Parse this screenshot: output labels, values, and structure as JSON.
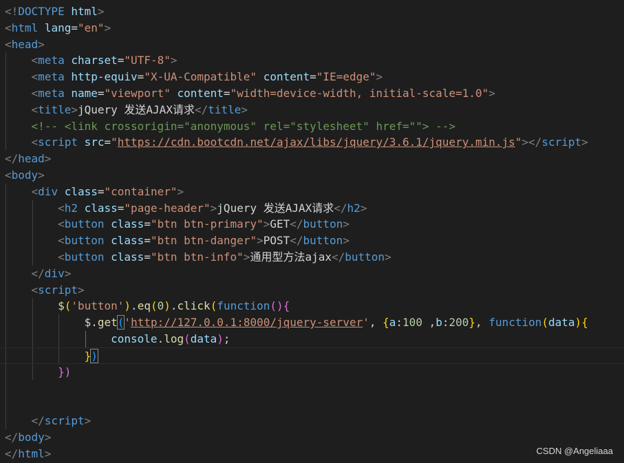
{
  "colors": {
    "background": "#1e1e1e",
    "tag": "#569cd6",
    "bracket": "#808080",
    "attribute": "#9cdcfe",
    "string": "#ce9178",
    "text": "#d4d4d4",
    "comment": "#6a9955",
    "function": "#dcdcaa",
    "number": "#b5cea8",
    "keyword": "#569cd6",
    "brace_gold": "#ffd700",
    "brace_purple": "#da70d6",
    "brace_blue": "#179fff"
  },
  "code": {
    "lines": [
      {
        "guides": [],
        "tokens": [
          {
            "t": "<!",
            "c": "bracket"
          },
          {
            "t": "DOCTYPE",
            "c": "tag"
          },
          {
            "t": " ",
            "c": "text"
          },
          {
            "t": "html",
            "c": "attribute"
          },
          {
            "t": ">",
            "c": "bracket"
          }
        ]
      },
      {
        "guides": [],
        "tokens": [
          {
            "t": "<",
            "c": "bracket"
          },
          {
            "t": "html",
            "c": "tag"
          },
          {
            "t": " ",
            "c": "text"
          },
          {
            "t": "lang",
            "c": "attribute"
          },
          {
            "t": "=",
            "c": "text"
          },
          {
            "t": "\"en\"",
            "c": "string"
          },
          {
            "t": ">",
            "c": "bracket"
          }
        ]
      },
      {
        "guides": [],
        "tokens": [
          {
            "t": "<",
            "c": "bracket"
          },
          {
            "t": "head",
            "c": "tag"
          },
          {
            "t": ">",
            "c": "bracket"
          }
        ]
      },
      {
        "guides": [
          1
        ],
        "tokens": [
          {
            "t": "    ",
            "c": "text"
          },
          {
            "t": "<",
            "c": "bracket"
          },
          {
            "t": "meta",
            "c": "tag"
          },
          {
            "t": " ",
            "c": "text"
          },
          {
            "t": "charset",
            "c": "attribute"
          },
          {
            "t": "=",
            "c": "text"
          },
          {
            "t": "\"UTF-8\"",
            "c": "string"
          },
          {
            "t": ">",
            "c": "bracket"
          }
        ]
      },
      {
        "guides": [
          1
        ],
        "tokens": [
          {
            "t": "    ",
            "c": "text"
          },
          {
            "t": "<",
            "c": "bracket"
          },
          {
            "t": "meta",
            "c": "tag"
          },
          {
            "t": " ",
            "c": "text"
          },
          {
            "t": "http-equiv",
            "c": "attribute"
          },
          {
            "t": "=",
            "c": "text"
          },
          {
            "t": "\"X-UA-Compatible\"",
            "c": "string"
          },
          {
            "t": " ",
            "c": "text"
          },
          {
            "t": "content",
            "c": "attribute"
          },
          {
            "t": "=",
            "c": "text"
          },
          {
            "t": "\"IE=edge\"",
            "c": "string"
          },
          {
            "t": ">",
            "c": "bracket"
          }
        ]
      },
      {
        "guides": [
          1
        ],
        "tokens": [
          {
            "t": "    ",
            "c": "text"
          },
          {
            "t": "<",
            "c": "bracket"
          },
          {
            "t": "meta",
            "c": "tag"
          },
          {
            "t": " ",
            "c": "text"
          },
          {
            "t": "name",
            "c": "attribute"
          },
          {
            "t": "=",
            "c": "text"
          },
          {
            "t": "\"viewport\"",
            "c": "string"
          },
          {
            "t": " ",
            "c": "text"
          },
          {
            "t": "content",
            "c": "attribute"
          },
          {
            "t": "=",
            "c": "text"
          },
          {
            "t": "\"width=device-width, initial-scale=1.0\"",
            "c": "string"
          },
          {
            "t": ">",
            "c": "bracket"
          }
        ]
      },
      {
        "guides": [
          1
        ],
        "tokens": [
          {
            "t": "    ",
            "c": "text"
          },
          {
            "t": "<",
            "c": "bracket"
          },
          {
            "t": "title",
            "c": "tag"
          },
          {
            "t": ">",
            "c": "bracket"
          },
          {
            "t": "jQuery 发送AJAX请求",
            "c": "text"
          },
          {
            "t": "</",
            "c": "bracket"
          },
          {
            "t": "title",
            "c": "tag"
          },
          {
            "t": ">",
            "c": "bracket"
          }
        ]
      },
      {
        "guides": [
          1
        ],
        "tokens": [
          {
            "t": "    ",
            "c": "text"
          },
          {
            "t": "<!-- <link crossorigin=\"anonymous\" rel=\"stylesheet\" href=\"\"> -->",
            "c": "comment"
          }
        ]
      },
      {
        "guides": [
          1
        ],
        "tokens": [
          {
            "t": "    ",
            "c": "text"
          },
          {
            "t": "<",
            "c": "bracket"
          },
          {
            "t": "script",
            "c": "tag"
          },
          {
            "t": " ",
            "c": "text"
          },
          {
            "t": "src",
            "c": "attribute"
          },
          {
            "t": "=",
            "c": "text"
          },
          {
            "t": "\"",
            "c": "string"
          },
          {
            "t": "https://cdn.bootcdn.net/ajax/libs/jquery/3.6.1/jquery.min.js",
            "c": "string",
            "u": true
          },
          {
            "t": "\"",
            "c": "string"
          },
          {
            "t": "></",
            "c": "bracket"
          },
          {
            "t": "script",
            "c": "tag"
          },
          {
            "t": ">",
            "c": "bracket"
          }
        ]
      },
      {
        "guides": [],
        "tokens": [
          {
            "t": "</",
            "c": "bracket"
          },
          {
            "t": "head",
            "c": "tag"
          },
          {
            "t": ">",
            "c": "bracket"
          }
        ]
      },
      {
        "guides": [],
        "tokens": [
          {
            "t": "<",
            "c": "bracket"
          },
          {
            "t": "body",
            "c": "tag"
          },
          {
            "t": ">",
            "c": "bracket"
          }
        ]
      },
      {
        "guides": [
          1
        ],
        "tokens": [
          {
            "t": "    ",
            "c": "text"
          },
          {
            "t": "<",
            "c": "bracket"
          },
          {
            "t": "div",
            "c": "tag"
          },
          {
            "t": " ",
            "c": "text"
          },
          {
            "t": "class",
            "c": "attribute"
          },
          {
            "t": "=",
            "c": "text"
          },
          {
            "t": "\"container\"",
            "c": "string"
          },
          {
            "t": ">",
            "c": "bracket"
          }
        ]
      },
      {
        "guides": [
          1,
          2
        ],
        "tokens": [
          {
            "t": "        ",
            "c": "text"
          },
          {
            "t": "<",
            "c": "bracket"
          },
          {
            "t": "h2",
            "c": "tag"
          },
          {
            "t": " ",
            "c": "text"
          },
          {
            "t": "class",
            "c": "attribute"
          },
          {
            "t": "=",
            "c": "text"
          },
          {
            "t": "\"page-header\"",
            "c": "string"
          },
          {
            "t": ">",
            "c": "bracket"
          },
          {
            "t": "jQuery 发送AJAX请求",
            "c": "text"
          },
          {
            "t": "</",
            "c": "bracket"
          },
          {
            "t": "h2",
            "c": "tag"
          },
          {
            "t": ">",
            "c": "bracket"
          }
        ]
      },
      {
        "guides": [
          1,
          2
        ],
        "tokens": [
          {
            "t": "        ",
            "c": "text"
          },
          {
            "t": "<",
            "c": "bracket"
          },
          {
            "t": "button",
            "c": "tag"
          },
          {
            "t": " ",
            "c": "text"
          },
          {
            "t": "class",
            "c": "attribute"
          },
          {
            "t": "=",
            "c": "text"
          },
          {
            "t": "\"btn btn-primary\"",
            "c": "string"
          },
          {
            "t": ">",
            "c": "bracket"
          },
          {
            "t": "GET",
            "c": "text"
          },
          {
            "t": "</",
            "c": "bracket"
          },
          {
            "t": "button",
            "c": "tag"
          },
          {
            "t": ">",
            "c": "bracket"
          }
        ]
      },
      {
        "guides": [
          1,
          2
        ],
        "tokens": [
          {
            "t": "        ",
            "c": "text"
          },
          {
            "t": "<",
            "c": "bracket"
          },
          {
            "t": "button",
            "c": "tag"
          },
          {
            "t": " ",
            "c": "text"
          },
          {
            "t": "class",
            "c": "attribute"
          },
          {
            "t": "=",
            "c": "text"
          },
          {
            "t": "\"btn btn-danger\"",
            "c": "string"
          },
          {
            "t": ">",
            "c": "bracket"
          },
          {
            "t": "POST",
            "c": "text"
          },
          {
            "t": "</",
            "c": "bracket"
          },
          {
            "t": "button",
            "c": "tag"
          },
          {
            "t": ">",
            "c": "bracket"
          }
        ]
      },
      {
        "guides": [
          1,
          2
        ],
        "tokens": [
          {
            "t": "        ",
            "c": "text"
          },
          {
            "t": "<",
            "c": "bracket"
          },
          {
            "t": "button",
            "c": "tag"
          },
          {
            "t": " ",
            "c": "text"
          },
          {
            "t": "class",
            "c": "attribute"
          },
          {
            "t": "=",
            "c": "text"
          },
          {
            "t": "\"btn btn-info\"",
            "c": "string"
          },
          {
            "t": ">",
            "c": "bracket"
          },
          {
            "t": "通用型方法ajax",
            "c": "text"
          },
          {
            "t": "</",
            "c": "bracket"
          },
          {
            "t": "button",
            "c": "tag"
          },
          {
            "t": ">",
            "c": "bracket"
          }
        ]
      },
      {
        "guides": [
          1
        ],
        "tokens": [
          {
            "t": "    ",
            "c": "text"
          },
          {
            "t": "</",
            "c": "bracket"
          },
          {
            "t": "div",
            "c": "tag"
          },
          {
            "t": ">",
            "c": "bracket"
          }
        ]
      },
      {
        "guides": [
          1
        ],
        "tokens": [
          {
            "t": "    ",
            "c": "text"
          },
          {
            "t": "<",
            "c": "bracket"
          },
          {
            "t": "script",
            "c": "tag"
          },
          {
            "t": ">",
            "c": "bracket"
          }
        ]
      },
      {
        "guides": [
          1,
          2
        ],
        "tokens": [
          {
            "t": "        ",
            "c": "text"
          },
          {
            "t": "$",
            "c": "function"
          },
          {
            "t": "(",
            "c": "brace_gold"
          },
          {
            "t": "'button'",
            "c": "string"
          },
          {
            "t": ")",
            "c": "brace_gold"
          },
          {
            "t": ".",
            "c": "text"
          },
          {
            "t": "eq",
            "c": "function"
          },
          {
            "t": "(",
            "c": "brace_gold"
          },
          {
            "t": "0",
            "c": "number"
          },
          {
            "t": ")",
            "c": "brace_gold"
          },
          {
            "t": ".",
            "c": "text"
          },
          {
            "t": "click",
            "c": "function"
          },
          {
            "t": "(",
            "c": "brace_gold"
          },
          {
            "t": "function",
            "c": "keyword"
          },
          {
            "t": "()",
            "c": "brace_purple"
          },
          {
            "t": "{",
            "c": "brace_purple"
          }
        ]
      },
      {
        "guides": [
          1,
          2,
          3
        ],
        "tokens": [
          {
            "t": "            ",
            "c": "text"
          },
          {
            "t": "$",
            "c": "text"
          },
          {
            "t": ".",
            "c": "text"
          },
          {
            "t": "get",
            "c": "function"
          },
          {
            "t": "(",
            "c": "brace_blue",
            "box": true
          },
          {
            "t": "'",
            "c": "string"
          },
          {
            "t": "http://127.0.0.1:8000/jquery-server",
            "c": "string",
            "u": true
          },
          {
            "t": "'",
            "c": "string"
          },
          {
            "t": ", ",
            "c": "text"
          },
          {
            "t": "{",
            "c": "brace_gold"
          },
          {
            "t": "a",
            "c": "attribute"
          },
          {
            "t": ":",
            "c": "text"
          },
          {
            "t": "100",
            "c": "number"
          },
          {
            "t": " ,",
            "c": "text"
          },
          {
            "t": "b",
            "c": "attribute"
          },
          {
            "t": ":",
            "c": "text"
          },
          {
            "t": "200",
            "c": "number"
          },
          {
            "t": "}",
            "c": "brace_gold"
          },
          {
            "t": ", ",
            "c": "text"
          },
          {
            "t": "function",
            "c": "keyword"
          },
          {
            "t": "(",
            "c": "brace_gold"
          },
          {
            "t": "data",
            "c": "attribute"
          },
          {
            "t": ")",
            "c": "brace_gold"
          },
          {
            "t": "{",
            "c": "brace_gold"
          }
        ]
      },
      {
        "guides": [
          1,
          2,
          3,
          4
        ],
        "activeGuide": 4,
        "tokens": [
          {
            "t": "                ",
            "c": "text"
          },
          {
            "t": "console",
            "c": "attribute"
          },
          {
            "t": ".",
            "c": "text"
          },
          {
            "t": "log",
            "c": "function"
          },
          {
            "t": "(",
            "c": "brace_purple"
          },
          {
            "t": "data",
            "c": "attribute"
          },
          {
            "t": ")",
            "c": "brace_purple"
          },
          {
            "t": ";",
            "c": "text"
          }
        ]
      },
      {
        "guides": [
          1,
          2,
          3
        ],
        "current": true,
        "tokens": [
          {
            "t": "            ",
            "c": "text"
          },
          {
            "t": "}",
            "c": "brace_gold"
          },
          {
            "t": ")",
            "c": "brace_blue",
            "box": true
          }
        ]
      },
      {
        "guides": [
          1,
          2
        ],
        "tokens": [
          {
            "t": "        ",
            "c": "text"
          },
          {
            "t": "})",
            "c": "brace_purple"
          }
        ]
      },
      {
        "guides": [
          1
        ],
        "tokens": []
      },
      {
        "guides": [
          1
        ],
        "tokens": []
      },
      {
        "guides": [
          1
        ],
        "tokens": [
          {
            "t": "    ",
            "c": "text"
          },
          {
            "t": "</",
            "c": "bracket"
          },
          {
            "t": "script",
            "c": "tag"
          },
          {
            "t": ">",
            "c": "bracket"
          }
        ]
      },
      {
        "guides": [],
        "tokens": [
          {
            "t": "</",
            "c": "bracket"
          },
          {
            "t": "body",
            "c": "tag"
          },
          {
            "t": ">",
            "c": "bracket"
          }
        ]
      },
      {
        "guides": [],
        "tokens": [
          {
            "t": "</",
            "c": "bracket"
          },
          {
            "t": "html",
            "c": "tag"
          },
          {
            "t": ">",
            "c": "bracket"
          }
        ]
      }
    ]
  },
  "watermark": {
    "text": "CSDN @Angeliaaa"
  }
}
